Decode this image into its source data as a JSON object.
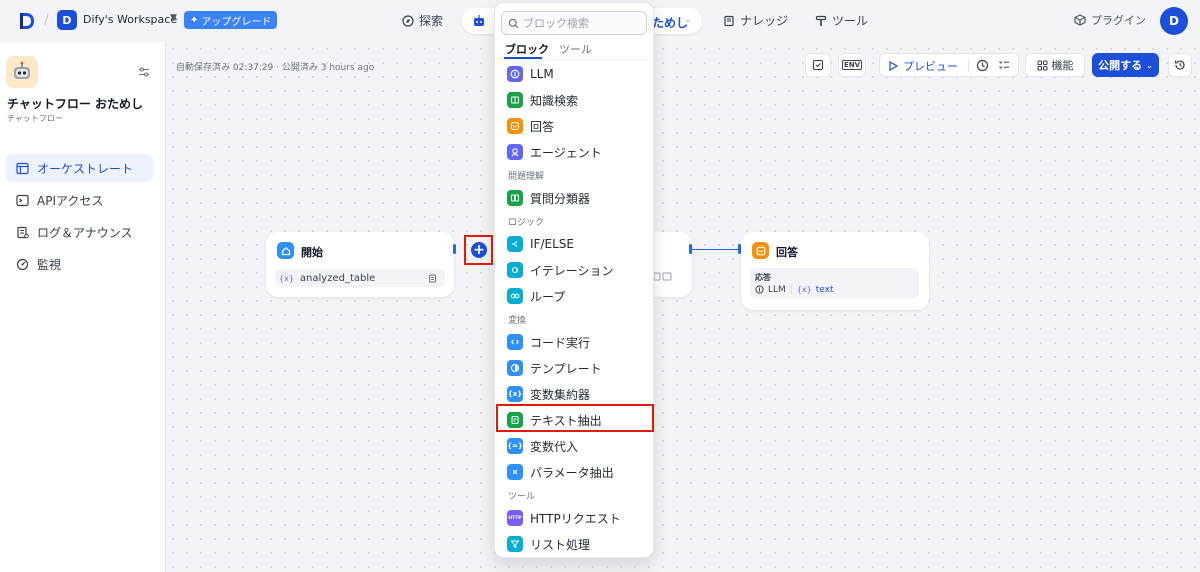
{
  "topbar": {
    "workspace_initial": "D",
    "workspace_name": "Dify's Workspace",
    "upgrade_label": "アップグレード",
    "nav": {
      "explore": "探索",
      "studio_tail": "ためし",
      "knowledge": "ナレッジ",
      "tools": "ツール"
    },
    "plugin_label": "プラグイン",
    "avatar_initial": "D"
  },
  "sidebar": {
    "app_name": "チャットフロー おためし",
    "app_type": "チャットフロー",
    "items": [
      {
        "label": "オーケストレート",
        "icon": "layout-icon",
        "active": true
      },
      {
        "label": "APIアクセス",
        "icon": "terminal-icon",
        "active": false
      },
      {
        "label": "ログ＆アナウンス",
        "icon": "log-icon",
        "active": false
      },
      {
        "label": "監視",
        "icon": "monitor-icon",
        "active": false
      }
    ]
  },
  "canvas": {
    "save_status": "自動保存済み 02:37:29 · 公開済み 3 hours ago",
    "toolbar": {
      "env_label": "ENV",
      "preview_label": "プレビュー",
      "features_label": "機能",
      "publish_label": "公開する"
    },
    "nodes": {
      "start": {
        "title": "開始",
        "var_prefix": "{x}",
        "var_name": "analyzed_table"
      },
      "answer": {
        "title": "回答",
        "field_label": "応答",
        "ref_llm": "LLM",
        "ref_prefix": "{x}",
        "ref_var": "text"
      }
    }
  },
  "picker": {
    "search_placeholder": "ブロック検索",
    "tabs": [
      "ブロック",
      "ツール"
    ],
    "groups": [
      {
        "category": "",
        "items": [
          "LLM",
          "知識検索",
          "回答",
          "エージェント"
        ]
      },
      {
        "category": "問題理解",
        "items": [
          "質問分類器"
        ]
      },
      {
        "category": "ロジック",
        "items": [
          "IF/ELSE",
          "イテレーション",
          "ループ"
        ]
      },
      {
        "category": "変換",
        "items": [
          "コード実行",
          "テンプレート",
          "変数集約器",
          "テキスト抽出",
          "変数代入",
          "パラメータ抽出"
        ]
      },
      {
        "category": "ツール",
        "items": [
          "HTTPリクエスト",
          "リスト処理"
        ]
      }
    ],
    "http_badge": "HTTP"
  },
  "colors": {
    "accent": "#1d4ed8",
    "highlight": "#e11d0a",
    "indigo": "#6366f1",
    "green": "#16a34a",
    "orange": "#f79009",
    "blue": "#2e90fa",
    "cyan": "#06aed4",
    "purple": "#7a5af8"
  }
}
